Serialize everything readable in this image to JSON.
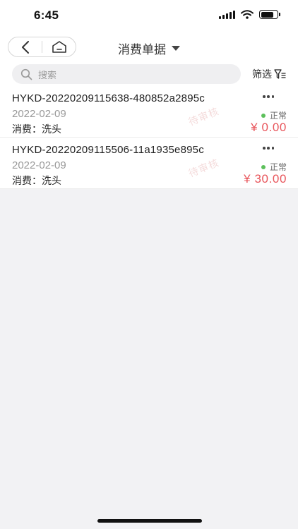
{
  "status_bar": {
    "time": "6:45"
  },
  "nav": {
    "title": "消费单据"
  },
  "search": {
    "placeholder": "搜索",
    "filter_label": "筛选"
  },
  "records": [
    {
      "order_id": "HYKD-20220209115638-480852a2895c",
      "date": "2022-02-09",
      "description": "消费：洗头",
      "status": "正常",
      "amount": "¥ 0.00",
      "stamp": "待审核"
    },
    {
      "order_id": "HYKD-20220209115506-11a1935e895c",
      "date": "2022-02-09",
      "description": "消费：洗头",
      "status": "正常",
      "amount": "¥ 30.00",
      "stamp": "待审核"
    }
  ],
  "colors": {
    "amount": "#e8555b",
    "status_dot": "#5cc05b",
    "page_background": "#f2f2f4",
    "card_background": "#ffffff"
  }
}
